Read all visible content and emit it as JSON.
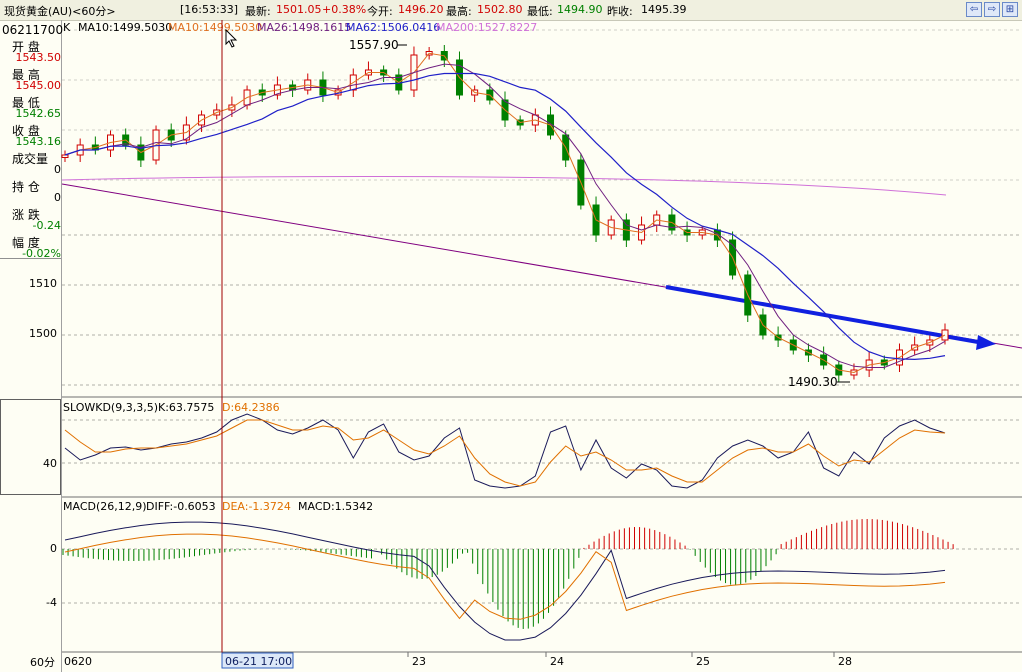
{
  "topbar": {
    "symbol": "现货黄金(AU)<60分>",
    "time": "[16:53:33]",
    "latest_label": "最新:",
    "latest_value": "1501.05",
    "change_pct": "+0.38%",
    "open_label": "今开:",
    "open_value": "1496.20",
    "high_label": "最高:",
    "high_value": "1502.80",
    "low_label": "最低:",
    "low_value": "1494.90",
    "prev_label": "昨收:",
    "prev_value": "1495.39",
    "icons": [
      "nav-left-icon",
      "nav-right-icon",
      "zoom-icon"
    ]
  },
  "panel": {
    "date": "06211700",
    "rows": [
      {
        "label": "开  盘",
        "value": "1543.50",
        "color": "#d00000"
      },
      {
        "label": "最  高",
        "value": "1545.00",
        "color": "#d00000"
      },
      {
        "label": "最  低",
        "value": "1542.65",
        "color": "#008000"
      },
      {
        "label": "收  盘",
        "value": "1543.16",
        "color": "#008000"
      },
      {
        "label": "成交量",
        "value": "0",
        "color": "#000000"
      },
      {
        "label": "持  仓",
        "value": "0",
        "color": "#000000"
      },
      {
        "label": "涨  跌",
        "value": "-0.24",
        "color": "#008000"
      },
      {
        "label": "幅  度",
        "value": "-0.02%",
        "color": "#008000"
      }
    ]
  },
  "legend_main": {
    "k": "K",
    "ma10a": "MA10:1499.5030",
    "ma10b": "MA10:1499.5030",
    "ma26": "MA26:1498.1615",
    "ma62": "MA62:1506.0416",
    "ma200": "MA200:1527.8227"
  },
  "legend_kd": {
    "name": "SLOWKD(9,3,3,5)",
    "k": "K:63.7575",
    "d": "D:64.2386"
  },
  "legend_macd": {
    "name": "MACD(26,12,9)",
    "diff": "DIFF:-0.6053",
    "dea": "DEA:-1.3724",
    "macd": "MACD:1.5342"
  },
  "annotations": {
    "high": "1557.90",
    "low": "1490.30"
  },
  "xaxis": {
    "period": "60分",
    "start": "0620",
    "cursor": "06-21 17:00",
    "days": [
      "23",
      "24",
      "25",
      "28"
    ]
  },
  "colors": {
    "up": "#d00000",
    "down": "#008000",
    "ma10": "#e07020",
    "ma26": "#702080",
    "ma62": "#2020c8",
    "ma200": "#d070d8",
    "kd_k": "#1a1a5a",
    "kd_d": "#e07000",
    "trend": "#1020e0",
    "cursor": "#a00000"
  },
  "chart_data": [
    {
      "type": "candlestick",
      "title": "现货黄金(AU)<60分>",
      "ylim": [
        1478,
        1562
      ],
      "y_ticks": [
        1510,
        1500
      ],
      "x_ticks": [
        "0620",
        "23",
        "24",
        "25",
        "28"
      ],
      "highlights": {
        "high": 1557.9,
        "low": 1490.3
      },
      "series_close": [
        1536,
        1538,
        1537,
        1540,
        1538,
        1535,
        1541,
        1539,
        1542,
        1544,
        1545,
        1546,
        1549,
        1548,
        1550,
        1549,
        1551,
        1548,
        1549,
        1552,
        1553,
        1552,
        1549,
        1556,
        1557,
        1555,
        1548,
        1549,
        1547,
        1543,
        1542,
        1544,
        1540,
        1535,
        1526,
        1520,
        1523,
        1519,
        1522,
        1524,
        1521,
        1520,
        1521,
        1519,
        1512,
        1504,
        1500,
        1499,
        1497,
        1496,
        1494,
        1492,
        1493,
        1495,
        1494,
        1497,
        1498,
        1499,
        1501
      ]
    },
    {
      "type": "line",
      "title": "SLOWKD(9,3,3,5)",
      "y_ticks": [
        40
      ],
      "series": [
        {
          "name": "K",
          "last": 63.7575
        },
        {
          "name": "D",
          "last": 64.2386
        }
      ]
    },
    {
      "type": "bar",
      "title": "MACD(26,12,9)",
      "y_ticks": [
        0,
        -4
      ],
      "series": [
        {
          "name": "DIFF",
          "last": -0.6053
        },
        {
          "name": "DEA",
          "last": -1.3724
        },
        {
          "name": "MACD",
          "last": 1.5342
        }
      ]
    }
  ]
}
